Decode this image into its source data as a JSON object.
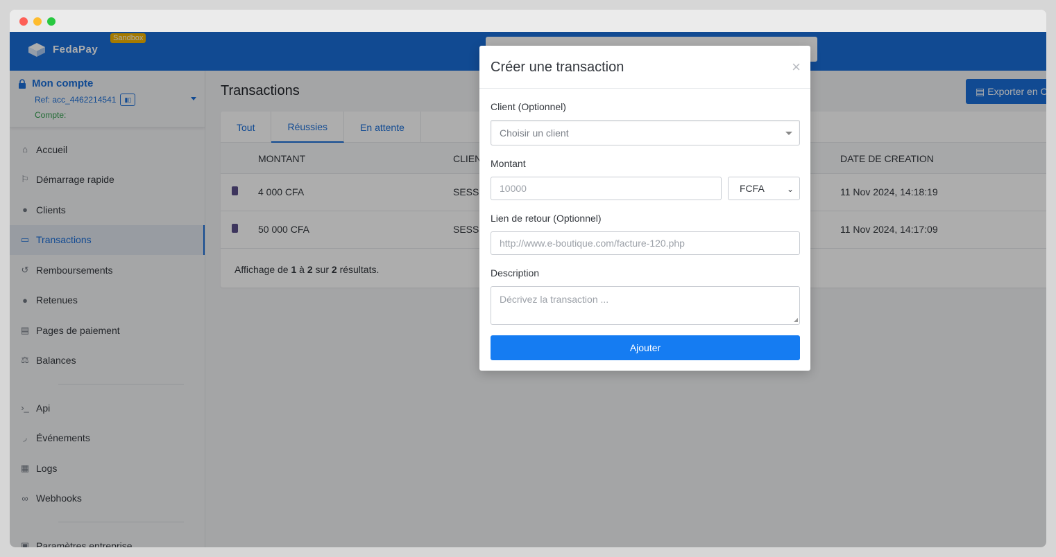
{
  "topbar": {
    "brand": "FedaPay",
    "badge": "Sandbox"
  },
  "account": {
    "title": "Mon compte",
    "ref": "Ref: acc_4462214541",
    "compte": "Compte:"
  },
  "sidebar": {
    "items": [
      {
        "label": "Accueil",
        "icon": "home-icon"
      },
      {
        "label": "Démarrage rapide",
        "icon": "flag-icon"
      },
      {
        "label": "Clients",
        "icon": "user-icon"
      },
      {
        "label": "Transactions",
        "icon": "money-icon"
      },
      {
        "label": "Remboursements",
        "icon": "refund-icon"
      },
      {
        "label": "Retenues",
        "icon": "alert-icon"
      },
      {
        "label": "Pages de paiement",
        "icon": "page-icon"
      },
      {
        "label": "Balances",
        "icon": "balance-icon"
      },
      {
        "label": "Api",
        "icon": "terminal-icon"
      },
      {
        "label": "Événements",
        "icon": "feed-icon"
      },
      {
        "label": "Logs",
        "icon": "logs-icon"
      },
      {
        "label": "Webhooks",
        "icon": "link-icon"
      },
      {
        "label": "Paramètres entreprise",
        "icon": "lock-icon"
      }
    ]
  },
  "main": {
    "title": "Transactions",
    "export_label": "Exporter en C",
    "tabs": [
      "Tout",
      "Réussies",
      "En attente"
    ],
    "columns": [
      "MONTANT",
      "CLIEN",
      "DATE DE CREATION"
    ],
    "rows": [
      {
        "amount": "4 000 CFA",
        "client": "SESS",
        "date": "11 Nov 2024, 14:18:19"
      },
      {
        "amount": "50 000 CFA",
        "client": "SESS",
        "date": "11 Nov 2024, 14:17:09"
      }
    ],
    "footer": {
      "prefix": "Affichage de ",
      "from": "1",
      "mid1": " à ",
      "to": "2",
      "mid2": " sur ",
      "total": "2",
      "suffix": " résultats."
    }
  },
  "modal": {
    "title": "Créer une transaction",
    "client_label": "Client (Optionnel)",
    "client_placeholder": "Choisir un client",
    "amount_label": "Montant",
    "amount_placeholder": "10000",
    "currency": "FCFA",
    "return_label": "Lien de retour (Optionnel)",
    "return_placeholder": "http://www.e-boutique.com/facture-120.php",
    "description_label": "Description",
    "description_placeholder": "Décrivez la transaction ...",
    "submit_label": "Ajouter"
  },
  "colors": {
    "brand": "#1a6ed8",
    "badge": "#f4b400",
    "submit": "#157cf2"
  }
}
